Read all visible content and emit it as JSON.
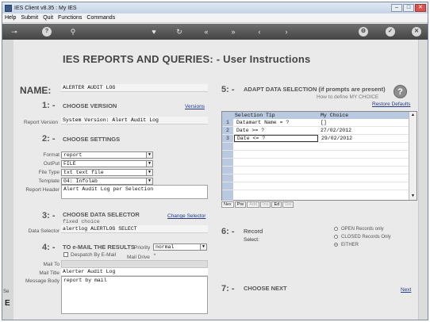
{
  "window": {
    "title": "IES Client v8.35 : My IES",
    "controls": [
      "–",
      "□",
      "✕"
    ]
  },
  "menu": [
    "Help",
    "Submit",
    "Quit",
    "Functions",
    "Commands"
  ],
  "toolbar": {
    "icons": [
      "key-icon",
      "help-icon",
      "search-icon",
      "heart-icon",
      "refresh-icon",
      "rewind-icon",
      "fast-forward-icon",
      "back-icon",
      "forward-icon",
      "gear-icon",
      "check-icon",
      "close-icon"
    ]
  },
  "left_strip": {
    "cap": "Se",
    "cap2": "E"
  },
  "page": {
    "title": "IES REPORTS AND QUERIES: -  User Instructions"
  },
  "name": {
    "label": "NAME:",
    "value": "ALERTER AUDIT LOG"
  },
  "step1": {
    "num": "1: -",
    "title": "CHOOSE VERSION",
    "link": "Versions",
    "version_label": "Report Version",
    "version_value": "System Version: Alert Audit Log"
  },
  "step2": {
    "num": "2: -",
    "title": "CHOOSE SETTINGS",
    "format_label": "Format",
    "format_value": "report",
    "output_label": "OutPut",
    "output_value": "FILE",
    "filetype_label": "File Type",
    "filetype_value": "txt text file",
    "template_label": "Template",
    "template_value": "04: Infolab",
    "header_label": "Report Header",
    "header_value": "Alert Audit Log per Selection"
  },
  "step3": {
    "num": "3: -",
    "title": "CHOOSE DATA SELECTOR",
    "link": "Change Selector",
    "fixed_choice": "fixed choice",
    "selector_label": "Data Selector",
    "selector_value": "alertlog ALERTLOG SELECT"
  },
  "step4": {
    "num": "4: -",
    "title": "TO e-MAIL THE RESULTS",
    "priority_label": "Priority",
    "priority_value": "normal",
    "despatch_label": "Despatch By E-Mail",
    "maildrive_label": "Mail Drive",
    "maildrive_value": "*",
    "mailto_label": "Mail To",
    "mailtitle_label": "Mail Title",
    "mailtitle_value": "Alerter Audit Log",
    "mailbody_label": "Message Body",
    "mailbody_value": "report by mail"
  },
  "step5": {
    "num": "5: -",
    "title": "ADAPT DATA SELECTION (if prompts are present)",
    "help_link": "How to define MY CHOICE",
    "restore_link": "Restore Defaults",
    "help_glyph": "?",
    "columns": [
      "Selection Tip",
      "My Choice"
    ],
    "rows": [
      {
        "n": "1",
        "tip": "Datamart Name = ?",
        "choice": "[]"
      },
      {
        "n": "2",
        "tip": "Date >= ?",
        "choice": "27/02/2012"
      },
      {
        "n": "3",
        "tip": "Date <= ?",
        "choice": "29/02/2012"
      }
    ],
    "tabs": [
      "Nex",
      "Pre",
      "Add",
      "Ins",
      "Ed",
      "Del"
    ]
  },
  "step6": {
    "num": "6: -",
    "title": "Record",
    "subtitle": "Select:",
    "options": [
      "OPEN Records only",
      "CLOSED Records Only",
      "EITHER"
    ],
    "selected": 2
  },
  "step7": {
    "num": "7: -",
    "title": "CHOOSE NEXT",
    "link": "Next"
  }
}
